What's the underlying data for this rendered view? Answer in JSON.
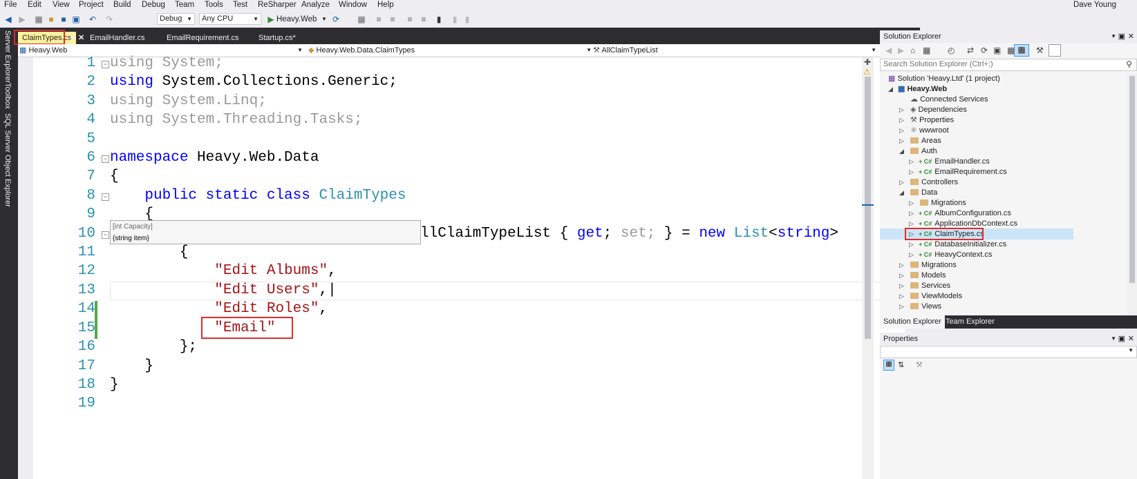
{
  "menu": [
    "File",
    "Edit",
    "View",
    "Project",
    "Build",
    "Debug",
    "Team",
    "Tools",
    "Test",
    "ReSharper",
    "Analyze",
    "Window",
    "Help"
  ],
  "user": "Dave Young",
  "toolbar": {
    "config": "Debug",
    "platform": "Any CPU",
    "run_label": "Heavy.Web"
  },
  "left_strip": [
    "Server Explorer",
    "Toolbox",
    "SQL Server Object Explorer"
  ],
  "tabs": [
    {
      "label": "ClaimTypes.cs",
      "active": true
    },
    {
      "label": "EmailHandler.cs"
    },
    {
      "label": "EmailRequirement.cs"
    },
    {
      "label": "Startup.cs*"
    }
  ],
  "navbar": {
    "project": "Heavy.Web",
    "type": "Heavy.Web.Data.ClaimTypes",
    "member": "AllClaimTypeList"
  },
  "line_numbers": [
    "1",
    "2",
    "3",
    "4",
    "5",
    "6",
    "7",
    "8",
    "9",
    "10",
    "11",
    "12",
    "13",
    "14",
    "15",
    "16",
    "17",
    "18",
    "19"
  ],
  "code": {
    "l1": "System;",
    "l2": "System.Collections.Generic;",
    "l3": "System.Linq;",
    "l4": "System.Threading.Tasks;",
    "ns": "Heavy.Web.Data",
    "cls": "ClaimTypes",
    "l10_name": "llClaimTypeList",
    "s1": "\"Edit Albums\"",
    "s2": "\"Edit Users\"",
    "s3": "\"Edit Roles\"",
    "s4": "\"Email\""
  },
  "tooltip": {
    "line1": "[int Capacity]",
    "line2": "{string item}"
  },
  "solution_explorer": {
    "title": "Solution Explorer",
    "search_placeholder": "Search Solution Explorer (Ctrl+;)",
    "items": [
      {
        "label": "Solution 'Heavy.Ltd' (1 project)",
        "icon": "solution-icon",
        "level": 0
      },
      {
        "label": "Heavy.Web",
        "icon": "project-icon",
        "level": 1,
        "bold": true
      },
      {
        "label": "Connected Services",
        "icon": "cloud-icon",
        "level": 2
      },
      {
        "label": "Dependencies",
        "icon": "dependencies-icon",
        "level": 2
      },
      {
        "label": "Properties",
        "icon": "wrench-icon",
        "level": 2
      },
      {
        "label": "wwwroot",
        "icon": "globe-icon",
        "level": 2
      },
      {
        "label": "Areas",
        "icon": "folder-icon",
        "level": 2
      },
      {
        "label": "Auth",
        "icon": "folder-icon",
        "level": 2
      },
      {
        "label": "EmailHandler.cs",
        "icon": "csharp-icon",
        "level": 3
      },
      {
        "label": "EmailRequirement.cs",
        "icon": "csharp-icon",
        "level": 3
      },
      {
        "label": "Controllers",
        "icon": "folder-icon",
        "level": 2
      },
      {
        "label": "Data",
        "icon": "folder-icon",
        "level": 2
      },
      {
        "label": "Migrations",
        "icon": "folder-icon",
        "level": 3
      },
      {
        "label": "AlbumConfiguration.cs",
        "icon": "csharp-icon",
        "level": 3
      },
      {
        "label": "ApplicationDbContext.cs",
        "icon": "csharp-icon",
        "level": 3
      },
      {
        "label": "ClaimTypes.cs",
        "icon": "csharp-icon",
        "level": 3,
        "selected": true
      },
      {
        "label": "DatabaseInitializer.cs",
        "icon": "csharp-icon",
        "level": 3
      },
      {
        "label": "HeavyContext.cs",
        "icon": "csharp-icon",
        "level": 3
      },
      {
        "label": "Migrations",
        "icon": "folder-icon",
        "level": 2
      },
      {
        "label": "Models",
        "icon": "folder-icon",
        "level": 2
      },
      {
        "label": "Services",
        "icon": "folder-icon",
        "level": 2
      },
      {
        "label": "ViewModels",
        "icon": "folder-icon",
        "level": 2
      },
      {
        "label": "Views",
        "icon": "folder-icon",
        "level": 2
      }
    ],
    "bottom_tabs": [
      "Solution Explorer",
      "Team Explorer"
    ]
  },
  "properties": {
    "title": "Properties"
  }
}
